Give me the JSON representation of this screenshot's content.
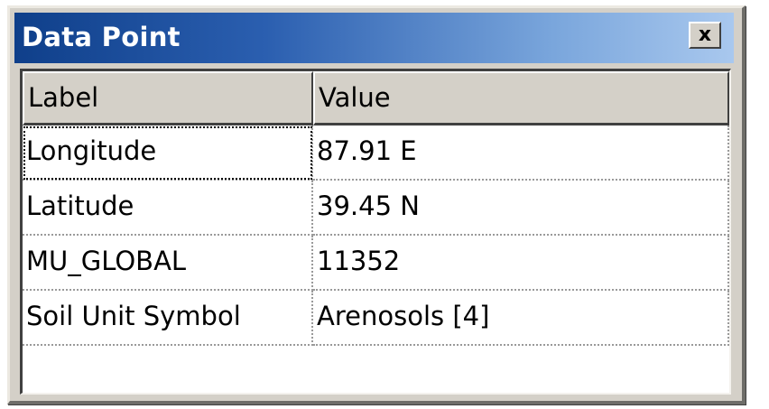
{
  "window": {
    "title": "Data Point",
    "close_label": "x"
  },
  "table": {
    "columns": [
      "Label",
      "Value"
    ],
    "rows": [
      {
        "label": "Longitude",
        "value": "87.91 E"
      },
      {
        "label": "Latitude",
        "value": "39.45 N"
      },
      {
        "label": "MU_GLOBAL",
        "value": "11352"
      },
      {
        "label": "Soil Unit Symbol",
        "value": "Arenosols [4]"
      }
    ]
  }
}
